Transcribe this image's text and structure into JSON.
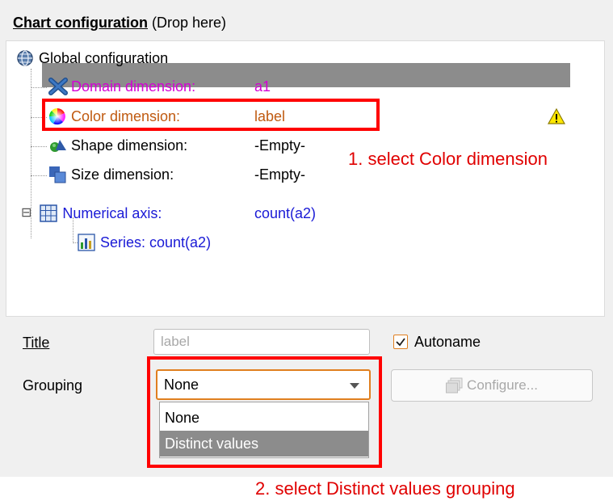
{
  "header": {
    "title_bold": "Chart configuration",
    "title_suffix": " (Drop here)"
  },
  "tree": {
    "global": {
      "label": "Global configuration",
      "icon": "globe-icon"
    },
    "domain": {
      "label": "Domain dimension:",
      "value": "a1",
      "color": "#d400d4",
      "icon": "cross-icon"
    },
    "color": {
      "label": "Color dimension:",
      "value": "label",
      "color": "#c05a10",
      "icon": "color-wheel-icon",
      "warning_icon": "warning-icon"
    },
    "shape": {
      "label": "Shape dimension:",
      "value": "-Empty-",
      "color": "#000000",
      "icon": "shapes-icon"
    },
    "size": {
      "label": "Size dimension:",
      "value": "-Empty-",
      "color": "#000000",
      "icon": "size-icon"
    },
    "numerical": {
      "label": "Numerical axis:",
      "value": "count(a2)",
      "color": "#1a1ad6",
      "icon": "grid-icon",
      "toggle": "⊟"
    },
    "series": {
      "label": "Series: count(a2)",
      "color": "#1a1ad6",
      "icon": "bar-chart-icon"
    }
  },
  "form": {
    "title_label": "Title",
    "title_value": "label",
    "autoname_label": "Autoname",
    "autoname_checked": true,
    "grouping_label": "Grouping",
    "grouping_value": "None",
    "configure_label": "Configure...",
    "grouping_options": [
      "None",
      "Distinct values"
    ]
  },
  "annotations": {
    "step1": "1. select Color dimension",
    "step2": "2. select Distinct values grouping",
    "color": "#e00000"
  }
}
